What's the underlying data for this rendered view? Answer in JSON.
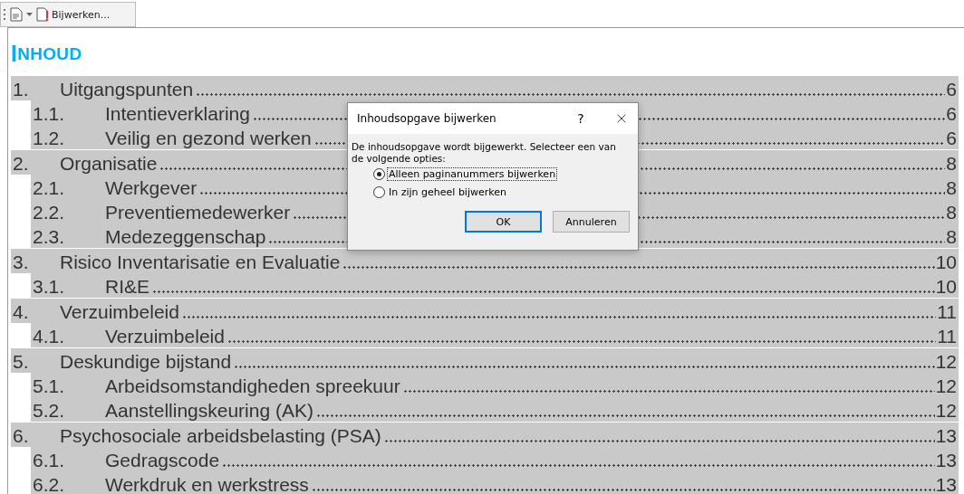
{
  "toolbar": {
    "update_button": "Bijwerken..."
  },
  "heading": "INHOUD",
  "toc": [
    {
      "number": "1.",
      "title": "Uitgangspunten",
      "page": "6",
      "children": [
        {
          "number": "1.1.",
          "title": "Intentieverklaring",
          "page": "6"
        },
        {
          "number": "1.2.",
          "title": "Veilig en gezond werken",
          "page": "6"
        }
      ]
    },
    {
      "number": "2.",
      "title": "Organisatie",
      "page": "8",
      "children": [
        {
          "number": "2.1.",
          "title": "Werkgever",
          "page": "8"
        },
        {
          "number": "2.2.",
          "title": "Preventiemedewerker",
          "page": "8"
        },
        {
          "number": "2.3.",
          "title": "Medezeggenschap",
          "page": "8"
        }
      ]
    },
    {
      "number": "3.",
      "title": "Risico Inventarisatie en Evaluatie",
      "page": "10",
      "children": [
        {
          "number": "3.1.",
          "title": "RI&E",
          "page": "10"
        }
      ]
    },
    {
      "number": "4.",
      "title": "Verzuimbeleid",
      "page": "11",
      "children": [
        {
          "number": "4.1.",
          "title": "Verzuimbeleid",
          "page": "11"
        }
      ]
    },
    {
      "number": "5.",
      "title": "Deskundige bijstand",
      "page": "12",
      "children": [
        {
          "number": "5.1.",
          "title": "Arbeidsomstandigheden spreekuur",
          "page": "12"
        },
        {
          "number": "5.2.",
          "title": "Aanstellingskeuring (AK)",
          "page": "12"
        }
      ]
    },
    {
      "number": "6.",
      "title": "Psychosociale arbeidsbelasting (PSA)",
      "page": "13",
      "children": [
        {
          "number": "6.1.",
          "title": "Gedragscode",
          "page": "13"
        },
        {
          "number": "6.2.",
          "title": "Werkdruk en werkstress",
          "page": "13"
        }
      ]
    }
  ],
  "dialog": {
    "title": "Inhoudsopgave bijwerken",
    "help": "?",
    "message": "De inhoudsopgave wordt bijgewerkt. Selecteer een van de volgende opties:",
    "options": [
      {
        "label": "Alleen paginanummers bijwerken",
        "selected": true
      },
      {
        "label": "In zijn geheel bijwerken",
        "selected": false
      }
    ],
    "buttons": [
      {
        "label": "OK",
        "kind": "default"
      },
      {
        "label": "Annuleren",
        "kind": "normal"
      }
    ]
  }
}
